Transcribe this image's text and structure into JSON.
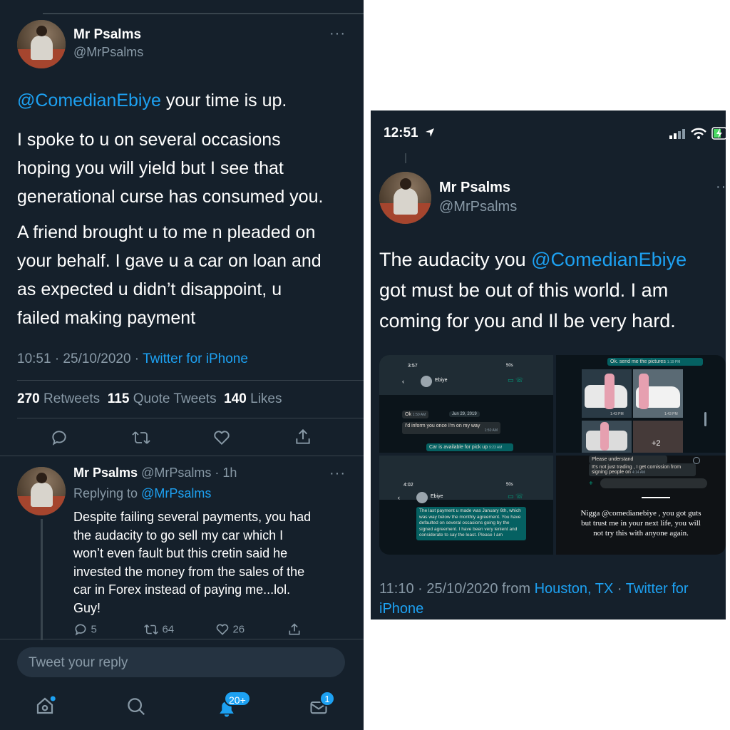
{
  "left": {
    "tweet": {
      "author_name": "Mr Psalms",
      "author_handle": "@MrPsalms",
      "mention": "@ComedianEbiye",
      "line1_rest": " your time is up.",
      "para2": [
        "I spoke to u on several occasions",
        "hoping you will yield but I see that",
        "generational curse has consumed you."
      ],
      "para3": [
        "A friend brought u to me n pleaded on",
        "your behalf. I gave u a car on loan and",
        "as expected u didn’t disappoint, u",
        "failed making payment"
      ],
      "timestamp": "10:51 · 25/10/2020 · ",
      "source": "Twitter for iPhone",
      "retweets_num": "270",
      "retweets_label": "Retweets",
      "quotes_num": "115",
      "quotes_label": "Quote Tweets",
      "likes_num": "140",
      "likes_label": "Likes"
    },
    "reply": {
      "author_name": "Mr Psalms",
      "author_handle": "@MrPsalms · 1h",
      "replying_to_label": "Replying to ",
      "replying_to_handle": "@MrPsalms",
      "lines": [
        "Despite failing several payments, you had",
        "the audacity to go sell my car which I",
        "won’t even fault but this cretin said he",
        "invested the money from the sales of the",
        "car in Forex instead of paying me...lol.",
        "Guy!"
      ],
      "reply_count": "5",
      "retweet_count": "64",
      "like_count": "26"
    },
    "compose": {
      "placeholder": "Tweet your reply"
    },
    "tabbar": {
      "notifications_badge": "20+",
      "messages_badge": "1"
    },
    "more_glyph": "···"
  },
  "right": {
    "status": {
      "time": "12:51"
    },
    "tweet": {
      "author_name": "Mr Psalms",
      "author_handle": "@MrPsalms",
      "text_prefix": "The audacity you ",
      "mention": "@ComedianEbiye",
      "lines_after": [
        "got must be out of this world. I am",
        "coming for you and Il be very hard."
      ],
      "timestamp": "11:10 · 25/10/2020 from ",
      "location": "Houston, TX",
      "sep": " · ",
      "source_line1": "Twitter for",
      "source_line2": "iPhone"
    },
    "media": {
      "shot1": {
        "time": "3:57",
        "contact": "Ebiye",
        "msg1": "Ok",
        "msg1_time": "1:50 AM",
        "date_chip": "Jun 29, 2019",
        "msg2": "I'd inform you once I'm on my way",
        "msg2_time": "1:50 AM",
        "msg3": "Car is available for pick up",
        "msg3_time": "9:23 AM",
        "signal": "50s"
      },
      "shot2": {
        "msg": "Ok. send me the pictures",
        "msg_time": "1:19 PM",
        "t1": "1:43 PM",
        "t2": "1:43 PM",
        "more": "+2"
      },
      "shot3": {
        "time": "4:02",
        "contact": "Ebiye",
        "signal": "50s",
        "msg": "The last payment u made was January 6th, which was way below the monthly agreement. You have defaulted on several occasions going by the signed agreement. I have been very lenient and considerate to say the least. Please I am"
      },
      "shot4": {
        "m1": "Please understand",
        "m2": "It's not just trading , I get comission from signing people on",
        "m2_time": "4:14 AM",
        "caption_lines": [
          "Nigga @comedianebiye , you got guts",
          "but trust me in your next life, you will",
          "not try this with anyone again."
        ]
      }
    },
    "more_glyph": "···"
  },
  "colors": {
    "bg": "#15202b",
    "accent": "#1da1f2",
    "muted": "#8899a6",
    "divider": "#38444d"
  }
}
